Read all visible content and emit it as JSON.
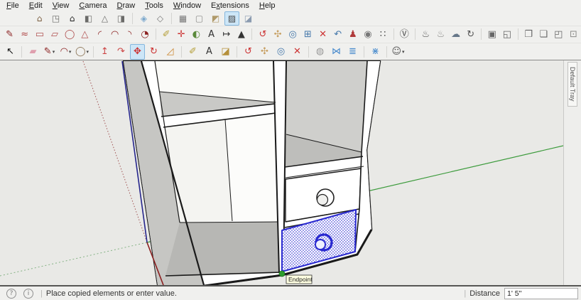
{
  "menu": {
    "items": [
      {
        "label": "File",
        "accel": 0
      },
      {
        "label": "Edit",
        "accel": 0
      },
      {
        "label": "View",
        "accel": 0
      },
      {
        "label": "Camera",
        "accel": 0
      },
      {
        "label": "Draw",
        "accel": 0
      },
      {
        "label": "Tools",
        "accel": 0
      },
      {
        "label": "Window",
        "accel": 0
      },
      {
        "label": "Extensions",
        "accel": 1
      },
      {
        "label": "Help",
        "accel": 0
      }
    ]
  },
  "toolbars": {
    "row1": [
      {
        "n": "view-iso",
        "g": "⌂",
        "c": "#7a5c3e"
      },
      {
        "n": "view-top",
        "g": "◳",
        "c": "#6b6b69"
      },
      {
        "n": "view-front",
        "g": "⌂",
        "c": "#222222"
      },
      {
        "n": "view-right",
        "g": "◧",
        "c": "#6b6b69"
      },
      {
        "n": "view-back",
        "g": "△",
        "c": "#6b6b69"
      },
      {
        "n": "view-left",
        "g": "◨",
        "c": "#6b6b69"
      },
      {
        "n": "sep"
      },
      {
        "n": "style-xray",
        "g": "◈",
        "c": "#7aa7cc"
      },
      {
        "n": "style-back-edges",
        "g": "◇",
        "c": "#777777"
      },
      {
        "n": "sep"
      },
      {
        "n": "style-wireframe",
        "g": "▦",
        "c": "#777777"
      },
      {
        "n": "style-hidden-line",
        "g": "▢",
        "c": "#8a8a88"
      },
      {
        "n": "style-shaded",
        "g": "◩",
        "c": "#b09a6a"
      },
      {
        "n": "style-shaded-textures",
        "g": "▨",
        "c": "#444444",
        "sel": true
      },
      {
        "n": "style-monochrome",
        "g": "◪",
        "c": "#8b9bb0"
      }
    ],
    "row2": [
      {
        "n": "line-tool",
        "g": "✎",
        "c": "#8b2020"
      },
      {
        "n": "freehand-tool",
        "g": "≈",
        "c": "#b04848"
      },
      {
        "n": "rectangle-tool",
        "g": "▭",
        "c": "#b05050"
      },
      {
        "n": "rotated-rectangle-tool",
        "g": "▱",
        "c": "#b05050"
      },
      {
        "n": "circle-tool",
        "g": "◯",
        "c": "#b05050"
      },
      {
        "n": "polygon-tool",
        "g": "△",
        "c": "#b05050"
      },
      {
        "n": "arc-tool",
        "g": "◜",
        "c": "#8b2020"
      },
      {
        "n": "two-point-arc-tool",
        "g": "◠",
        "c": "#8b2020"
      },
      {
        "n": "three-point-arc-tool",
        "g": "◝",
        "c": "#8b2020"
      },
      {
        "n": "pie-tool",
        "g": "◔",
        "c": "#8b2020"
      },
      {
        "n": "sep"
      },
      {
        "n": "tape-measure-tool",
        "g": "✐",
        "c": "#b5a03a"
      },
      {
        "n": "axes-tool",
        "g": "✛",
        "c": "#cc3333"
      },
      {
        "n": "protractor-tool",
        "g": "◐",
        "c": "#5a8a3a"
      },
      {
        "n": "text-tool",
        "g": "A",
        "c": "#333333"
      },
      {
        "n": "dimensions-tool",
        "g": "↦",
        "c": "#333333"
      },
      {
        "n": "3d-text-tool",
        "g": "▲",
        "c": "#333333"
      },
      {
        "n": "sep"
      },
      {
        "n": "orbit-tool",
        "g": "↺",
        "c": "#cc3333"
      },
      {
        "n": "pan-tool",
        "g": "✣",
        "c": "#c8a165"
      },
      {
        "n": "zoom-tool",
        "g": "◎",
        "c": "#4477aa"
      },
      {
        "n": "zoom-window-tool",
        "g": "⊞",
        "c": "#4477aa"
      },
      {
        "n": "zoom-extents-tool",
        "g": "✕",
        "c": "#cc3333"
      },
      {
        "n": "previous-view-tool",
        "g": "↶",
        "c": "#4477aa"
      },
      {
        "n": "position-camera-tool",
        "g": "♟",
        "c": "#b03a3a"
      },
      {
        "n": "look-around-tool",
        "g": "◉",
        "c": "#777777"
      },
      {
        "n": "walk-tool",
        "g": "∷",
        "c": "#444444"
      },
      {
        "n": "sep"
      },
      {
        "n": "vray-logo",
        "g": "Ⓥ",
        "c": "#444444"
      },
      {
        "n": "sep"
      },
      {
        "n": "vray-render",
        "g": "♨",
        "c": "#555555"
      },
      {
        "n": "vray-render-interactive",
        "g": "♨",
        "c": "#8a8a88"
      },
      {
        "n": "vray-cloud-render",
        "g": "☁",
        "c": "#667788"
      },
      {
        "n": "vray-batch-render",
        "g": "↻",
        "c": "#555555"
      },
      {
        "n": "sep"
      },
      {
        "n": "vray-frame-buffer",
        "g": "▣",
        "c": "#666666"
      },
      {
        "n": "vray-history",
        "g": "◱",
        "c": "#666666"
      },
      {
        "n": "sep"
      },
      {
        "n": "vray-asset-editor",
        "g": "❐",
        "c": "#666666"
      },
      {
        "n": "vray-file-manager",
        "g": "❏",
        "c": "#666666"
      },
      {
        "n": "vray-log-window",
        "g": "◰",
        "c": "#666666"
      },
      {
        "n": "vray-lock-camera",
        "g": "⊡",
        "c": "#8a8a88"
      }
    ],
    "row3": [
      {
        "n": "select-tool",
        "g": "↖",
        "c": "#111111"
      },
      {
        "n": "sep"
      },
      {
        "n": "eraser-tool",
        "g": "▰",
        "c": "#df9fae"
      },
      {
        "n": "line-flyout",
        "g": "✎",
        "c": "#8b2020",
        "dd": true
      },
      {
        "n": "arc-flyout",
        "g": "◠",
        "c": "#8b2020",
        "dd": true
      },
      {
        "n": "shape-flyout",
        "g": "◯",
        "c": "#8b7355",
        "dd": true
      },
      {
        "n": "sep"
      },
      {
        "n": "push-pull-tool",
        "g": "↥",
        "c": "#cc4444"
      },
      {
        "n": "follow-me-tool",
        "g": "↷",
        "c": "#cc4444"
      },
      {
        "n": "move-tool",
        "g": "✥",
        "c": "#cc3333",
        "sel": true
      },
      {
        "n": "rotate-tool",
        "g": "↻",
        "c": "#cc3333"
      },
      {
        "n": "scale-tool",
        "g": "◿",
        "c": "#cc8833"
      },
      {
        "n": "sep"
      },
      {
        "n": "tape-measure-tool-2",
        "g": "✐",
        "c": "#b5a03a"
      },
      {
        "n": "text-tool-2",
        "g": "A",
        "c": "#333333"
      },
      {
        "n": "paint-bucket-tool",
        "g": "◪",
        "c": "#b5903a"
      },
      {
        "n": "sep"
      },
      {
        "n": "orbit-tool-2",
        "g": "↺",
        "c": "#cc3333"
      },
      {
        "n": "pan-tool-2",
        "g": "✣",
        "c": "#c8a165"
      },
      {
        "n": "zoom-tool-2",
        "g": "◎",
        "c": "#4477aa"
      },
      {
        "n": "zoom-extents-tool-2",
        "g": "✕",
        "c": "#cc3333"
      },
      {
        "n": "sep"
      },
      {
        "n": "section-plane-tool",
        "g": "◍",
        "c": "#999999"
      },
      {
        "n": "display-section-cuts",
        "g": "⋈",
        "c": "#4488cc"
      },
      {
        "n": "display-section-fill",
        "g": "≣",
        "c": "#4488cc"
      },
      {
        "n": "sep"
      },
      {
        "n": "display-section-outlines",
        "g": "⋇",
        "c": "#4488cc"
      },
      {
        "n": "sep"
      },
      {
        "n": "account",
        "g": "☺",
        "c": "#555555",
        "dd": true
      }
    ]
  },
  "viewport": {
    "bg": "#e9e9e6",
    "tray_tab": "Default Tray",
    "selection_color": "#2a2ad0",
    "axes": {
      "red_solid": "#8b1f1f",
      "red_dotted": "#a05252",
      "green_solid": "#3c9b3c",
      "green_dashed": "#84b284",
      "blue_solid": "#26268c"
    },
    "endpoint": {
      "label": "Endpoint",
      "dot_color": "#2e9e2e",
      "tooltip_bg": "#ffffe1"
    }
  },
  "status_bar": {
    "geolocation_icon_glyph": "?",
    "credits_icon_glyph": "i",
    "message": "Place copied elements or enter value.",
    "distance_label": "Distance",
    "distance_value": "1' 5\""
  }
}
